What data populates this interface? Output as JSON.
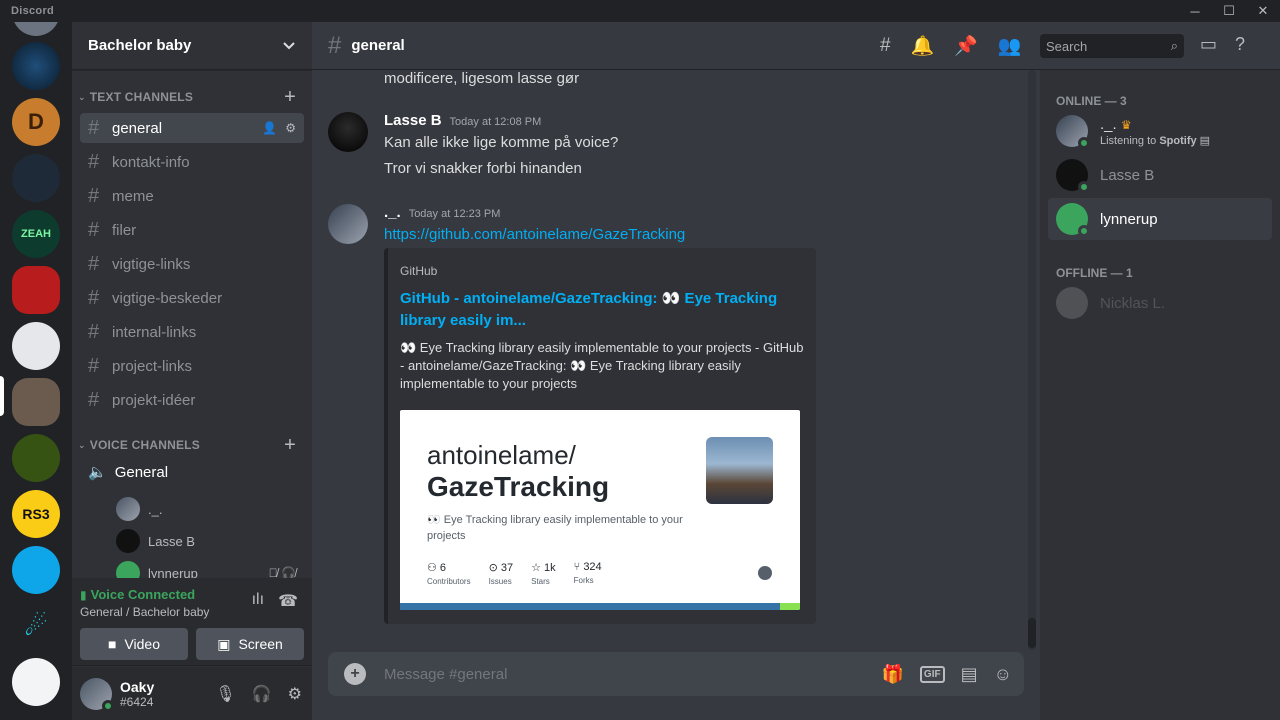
{
  "app": {
    "title": "Discord",
    "window_controls": [
      "─",
      "☐",
      "✕"
    ]
  },
  "server": {
    "name": "Bachelor baby"
  },
  "sidebar": {
    "text_category": "TEXT CHANNELS",
    "voice_category": "VOICE CHANNELS",
    "text_channels": [
      {
        "name": "general",
        "active": true
      },
      {
        "name": "kontakt-info"
      },
      {
        "name": "meme"
      },
      {
        "name": "filer"
      },
      {
        "name": "vigtige-links"
      },
      {
        "name": "vigtige-beskeder"
      },
      {
        "name": "internal-links"
      },
      {
        "name": "project-links"
      },
      {
        "name": "projekt-idéer"
      }
    ],
    "voice_channels": [
      {
        "name": "General"
      }
    ],
    "voice_users": [
      "._.",
      "Lasse B",
      "lynnerup"
    ]
  },
  "voice_panel": {
    "status": "Voice Connected",
    "location": "General / Bachelor baby",
    "video_label": "Video",
    "screen_label": "Screen"
  },
  "user": {
    "name": "Oaky",
    "tag": "#6424"
  },
  "channel": {
    "name": "general"
  },
  "search": {
    "placeholder": "Search"
  },
  "messages": {
    "partial": "modificere, ligesom lasse gør",
    "m1": {
      "author": "Lasse B",
      "timestamp": "Today at 12:08 PM",
      "lines": [
        "Kan alle ikke lige komme på voice?",
        "Tror vi snakker forbi hinanden"
      ]
    },
    "m2": {
      "author": "._.",
      "timestamp": "Today at 12:23 PM",
      "link": "https://github.com/antoinelame/GazeTracking"
    }
  },
  "embed": {
    "provider": "GitHub",
    "title": "GitHub - antoinelame/GazeTracking: 👀 Eye Tracking library easily im...",
    "description": "👀 Eye Tracking library easily implementable to your projects - GitHub - antoinelame/GazeTracking: 👀 Eye Tracking library easily implementable to your projects",
    "card": {
      "owner": "antoinelame/",
      "repo": "GazeTracking",
      "desc": "👀 Eye Tracking library easily implementable to your projects",
      "stats": [
        {
          "value": "6",
          "label": "Contributors"
        },
        {
          "value": "37",
          "label": "Issues"
        },
        {
          "value": "1k",
          "label": "Stars"
        },
        {
          "value": "324",
          "label": "Forks"
        }
      ]
    }
  },
  "composer": {
    "placeholder": "Message #general",
    "gif_label": "GIF"
  },
  "members": {
    "online_header": "ONLINE — 3",
    "offline_header": "OFFLINE — 1",
    "online": [
      {
        "name": "._.",
        "activity_prefix": "Listening to ",
        "activity": "Spotify"
      },
      {
        "name": "Lasse B"
      },
      {
        "name": "lynnerup"
      }
    ],
    "offline": [
      {
        "name": "Nicklas L."
      }
    ]
  },
  "colors": {
    "accent": "#5865f2",
    "online": "#3ba55d",
    "link": "#00aff4",
    "background": "#36393f"
  }
}
